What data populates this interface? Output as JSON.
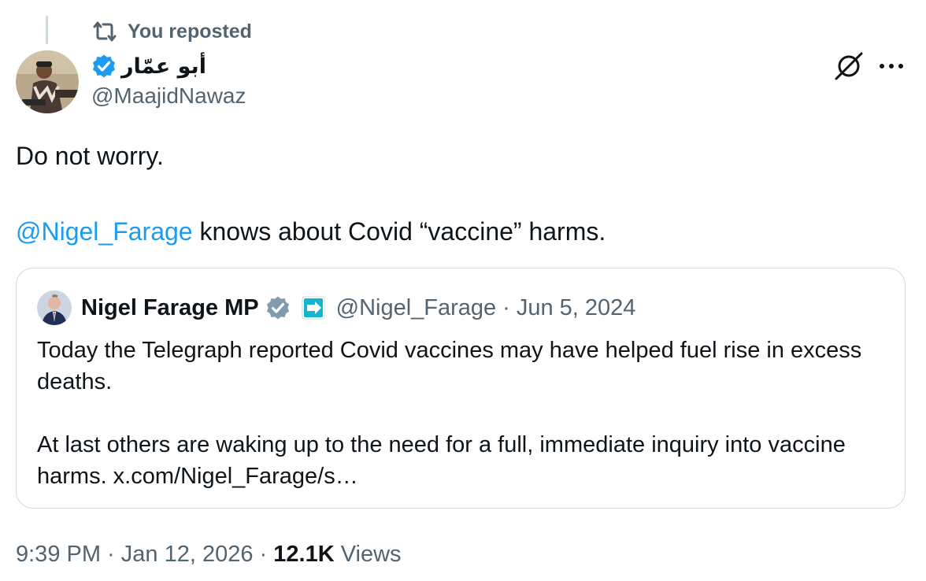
{
  "repost": {
    "label": "You reposted",
    "icon": "repost-icon"
  },
  "author": {
    "display_name": "أبو عمّار",
    "handle": "@MaajidNawaz",
    "verified": true,
    "verified_color": "#1d9bf0"
  },
  "actions": {
    "grok_icon": "grok-icon",
    "more_icon": "more-icon"
  },
  "tweet": {
    "line1": "Do not worry.",
    "mention": "@Nigel_Farage",
    "line2_rest": " knows about Covid “vaccine” harms."
  },
  "quote": {
    "display_name": "Nigel Farage MP",
    "verified_color": "#829aab",
    "affiliation_icon": "reform-uk-icon",
    "handle": "@Nigel_Farage",
    "separator": " · ",
    "date": "Jun 5, 2024",
    "text": "Today the Telegraph reported Covid vaccines may have helped fuel rise in excess deaths.\n\nAt last others are waking up to the need for a full, immediate inquiry into vaccine harms. x.com/Nigel_Farage/s…"
  },
  "footer": {
    "time": "9:39 PM",
    "separator": " · ",
    "date": "Jan 12, 2026",
    "views_count": "12.1K",
    "views_label": "Views"
  },
  "colors": {
    "link": "#1d9bf0",
    "secondary_text": "#536471",
    "border": "#cfd9de"
  }
}
